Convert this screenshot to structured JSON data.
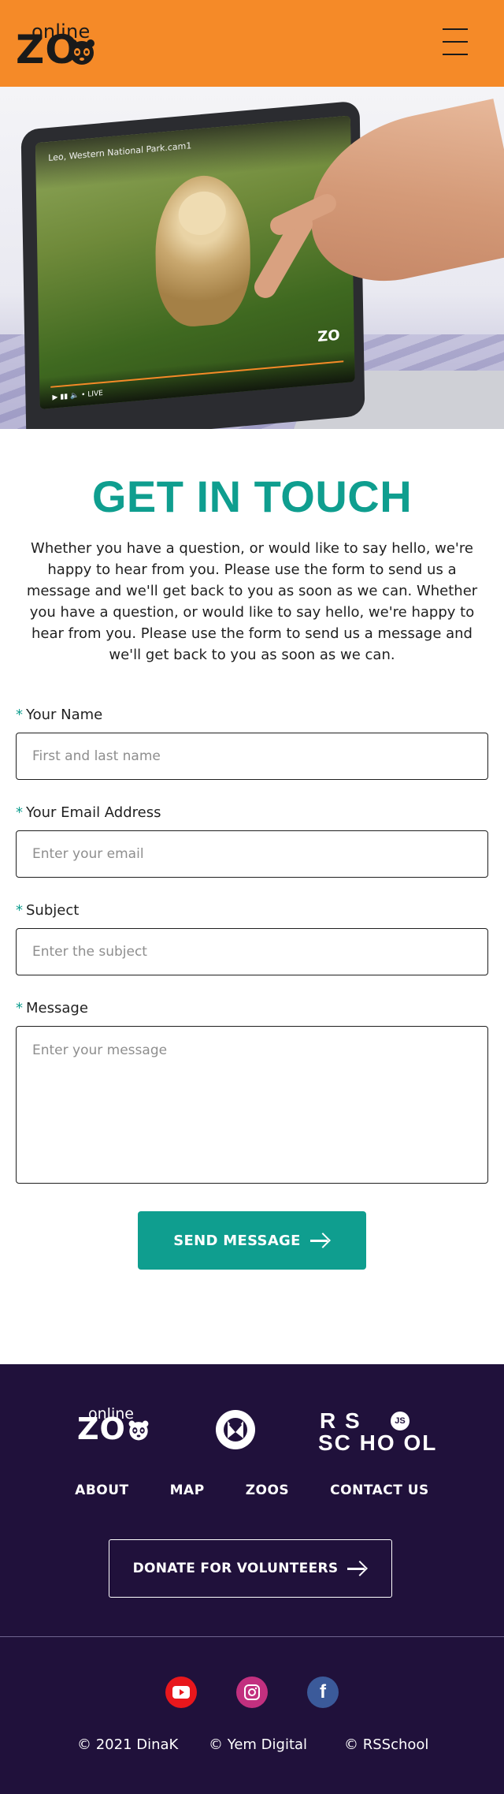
{
  "header": {
    "logo_small": "online",
    "logo_big": "ZO"
  },
  "hero": {
    "video_caption": "Leo, Western National Park.cam1",
    "live_label": "LIVE",
    "screen_logo": "ZO"
  },
  "contact": {
    "title": "GET IN TOUCH",
    "intro": "Whether you have a question, or would like to say hello, we're happy to hear from you. Please use the form to send us a message and we'll get back to you as soon as we can. Whether you have a question, or would like to say hello, we're happy to hear from you. Please use the form to send us a message and we'll get back to you as soon as we can.",
    "fields": {
      "name": {
        "label": "Your Name",
        "placeholder": "First and last name",
        "value": ""
      },
      "email": {
        "label": "Your Email Address",
        "placeholder": "Enter your email",
        "value": ""
      },
      "subject": {
        "label": "Subject",
        "placeholder": "Enter the subject",
        "value": ""
      },
      "message": {
        "label": "Message",
        "placeholder": "Enter your message",
        "value": ""
      }
    },
    "required_mark": "*",
    "send_label": "SEND MESSAGE"
  },
  "footer": {
    "logo_small": "online",
    "logo_big": "ZO",
    "rs_line1": "R  S",
    "rs_line2": "SC HO OL",
    "rs_js": "JS",
    "nav": [
      "ABOUT",
      "MAP",
      "ZOOS",
      "CONTACT US"
    ],
    "donate_label": "DONATE FOR VOLUNTEERS",
    "social": [
      "youtube-icon",
      "instagram-icon",
      "facebook-icon"
    ],
    "copyright": [
      "© 2021 DinaK",
      "© Yem Digital",
      "© RSSchool"
    ]
  },
  "colors": {
    "header_bg": "#f58a28",
    "accent_teal": "#0f9e8f",
    "footer_bg": "#20113b",
    "youtube_red": "#e8171c",
    "instagram": "#c2307f",
    "facebook_blue": "#3b5a9a"
  }
}
